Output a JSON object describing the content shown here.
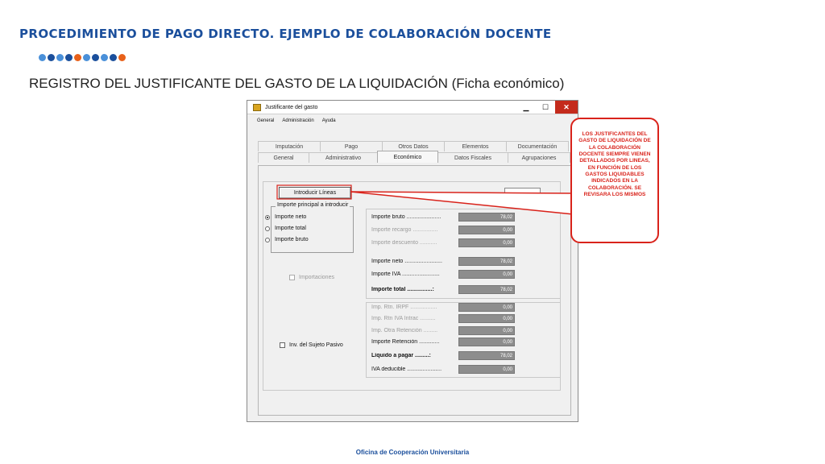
{
  "slide": {
    "heading": "PROCEDIMIENTO DE PAGO DIRECTO. EJEMPLO DE COLABORACIÓN DOCENTE",
    "subtitle": "REGISTRO DEL JUSTIFICANTE DEL GASTO DE LA LIQUIDACIÓN  (Ficha económico)",
    "footer": "Oficina de Cooperación Universitaria",
    "dot_colors": [
      "#4a90d9",
      "#1b4f9c",
      "#4a90d9",
      "#1b4f9c",
      "#e8611a",
      "#4a90d9",
      "#1b4f9c",
      "#4a90d9",
      "#1b4f9c",
      "#e8611a"
    ]
  },
  "window": {
    "title": "Justificante del gasto",
    "controls": {
      "minimize": "▁",
      "maximize": "☐",
      "close": "✕"
    },
    "menu": [
      "General",
      "Administración",
      "Ayuda"
    ],
    "tabs_back": [
      "Imputación",
      "Pago",
      "Otros Datos",
      "Elementos",
      "Documentación"
    ],
    "tabs_front": [
      "General",
      "Administrativo",
      "Económico",
      "Datos Fiscales",
      "Agrupaciones"
    ],
    "active_tab": "Económico"
  },
  "form": {
    "introducir_lineas": "Introducir Líneas",
    "group_title": "Importe principal a introducir",
    "radios": [
      {
        "label": "Importe neto",
        "selected": true
      },
      {
        "label": "Importe total",
        "selected": false
      },
      {
        "label": "Importe bruto",
        "selected": false
      }
    ],
    "importaciones": "Importaciones",
    "sujeto_pasivo": "Inv. del Sujeto Pasivo",
    "amounts_top": [
      {
        "label": "Importe bruto ......................",
        "value": "78,02",
        "style": "normal"
      },
      {
        "label": "Importe recargo ................",
        "value": "0,00",
        "style": "disabled"
      },
      {
        "label": "Importe descuento ...........",
        "value": "0,00",
        "style": "disabled"
      },
      {
        "label": "Importe neto ........................",
        "value": "78,02",
        "style": "normal"
      },
      {
        "label": "Importe IVA ........................",
        "value": "0,00",
        "style": "normal"
      },
      {
        "label": "Importe total ................:",
        "value": "78,02",
        "style": "bold"
      }
    ],
    "amounts_bottom": [
      {
        "label": "Imp. Rtn. IRPF .................",
        "value": "0,00",
        "style": "disabled"
      },
      {
        "label": "Imp. Rtn IVA Intrac ..........",
        "value": "0,00",
        "style": "disabled"
      },
      {
        "label": "Imp. Otra Retención .........",
        "value": "0,00",
        "style": "disabled"
      },
      {
        "label": "Importe Retención .............",
        "value": "0,00",
        "style": "normal"
      },
      {
        "label": "Líquido a pagar .........:",
        "value": "78,02",
        "style": "bold"
      },
      {
        "label": "IVA deducible ......................",
        "value": "0,00",
        "style": "normal"
      }
    ]
  },
  "callout": {
    "text": "LOS JUSTIFICANTES DEL GASTO DE LIQUIDACIÓN DE LA COLABORACIÓN DOCENTE SIEMPRE VIENEN DETALLADOS POR LINEAS, EN FUNCIÓN DE LOS GASTOS LIQUIDABLES INDICADOS EN LA COLABORACIÓN. SE REVISARA LOS MISMOS",
    "color": "#d9231b"
  }
}
